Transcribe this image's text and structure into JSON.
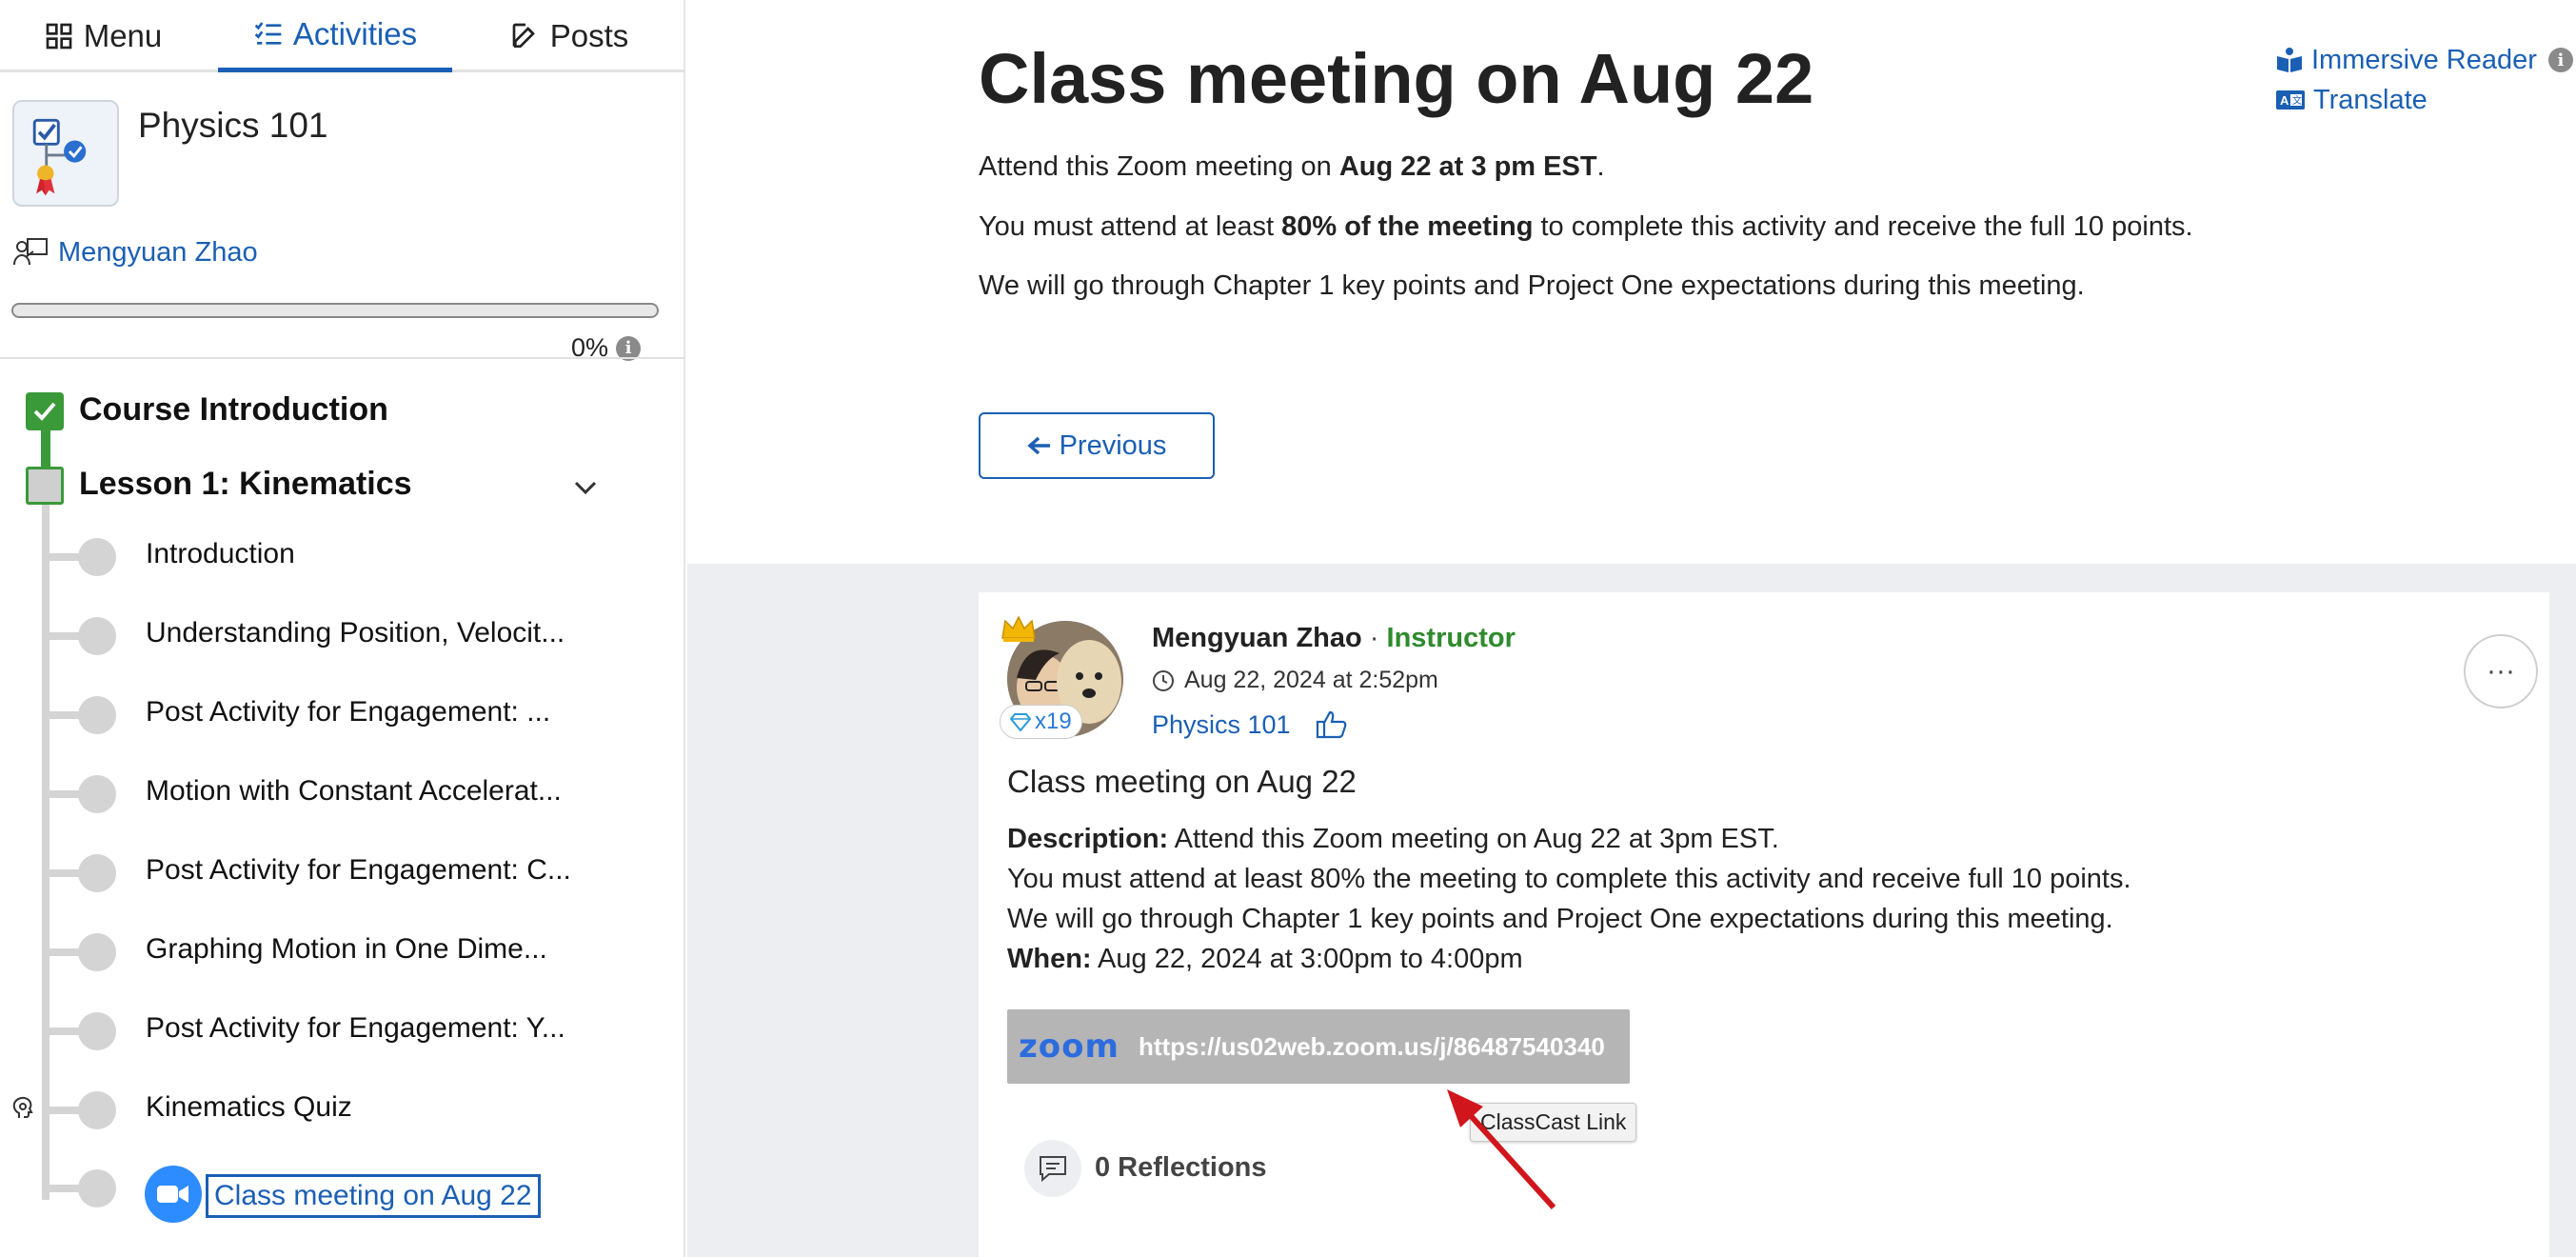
{
  "tabs": [
    {
      "label": "Menu",
      "icon": "grid-icon"
    },
    {
      "label": "Activities",
      "icon": "checklist-icon"
    },
    {
      "label": "Posts",
      "icon": "edit-icon"
    }
  ],
  "course": {
    "title": "Physics 101",
    "instructor": "Mengyuan Zhao",
    "progress_label": "0%",
    "progress_fraction": 0
  },
  "outline": {
    "section_1": "Course Introduction",
    "section_2": "Lesson 1: Kinematics",
    "activities": [
      "Introduction",
      "Understanding Position, Velocit...",
      "Post Activity for Engagement: ...",
      "Motion with Constant Accelerat...",
      "Post Activity for Engagement: C...",
      "Graphing Motion in One Dime...",
      "Post Activity for Engagement: Y...",
      "Kinematics Quiz"
    ],
    "current_activity": "Class meeting on Aug 22"
  },
  "main": {
    "title": "Class meeting on Aug 22",
    "p1_a": "Attend this Zoom meeting on ",
    "p1_b": "Aug 22 at 3 pm EST",
    "p1_c": ".",
    "p2_a": "You must attend at least ",
    "p2_b": "80% of the meeting",
    "p2_c": " to complete this activity and receive the full 10 points.",
    "p3": "We will go through Chapter 1 key points and Project One expectations during this meeting.",
    "immersive_reader": "Immersive Reader",
    "translate": "Translate",
    "previous_button": "Previous"
  },
  "post": {
    "author": "Mengyuan Zhao",
    "separator": "·",
    "role": "Instructor",
    "gem_count": "x19",
    "timestamp": "Aug 22, 2024 at 2:52pm",
    "course": "Physics 101",
    "more": "···",
    "title": "Class meeting on Aug 22",
    "desc_label": "Description:",
    "desc_line1": " Attend this Zoom meeting on Aug 22 at 3pm EST.",
    "desc_line2": "You must attend at least 80% the meeting to complete this activity and receive full 10 points.",
    "desc_line3": "We will go through Chapter 1 key points and Project One expectations during this meeting.",
    "when_label": "When:",
    "when_value": " Aug 22, 2024 at 3:00pm to 4:00pm",
    "zoom_logo": "zoom",
    "zoom_url": "https://us02web.zoom.us/j/86487540340",
    "tooltip": "ClassCast Link",
    "reflections": "0 Reflections"
  },
  "colors": {
    "accent": "#1a5fb4",
    "complete_green": "#3a9a3a",
    "instructor_green": "#2e8b2e",
    "zoom_blue": "#2d8cff",
    "annotation_red": "#d0161c"
  }
}
